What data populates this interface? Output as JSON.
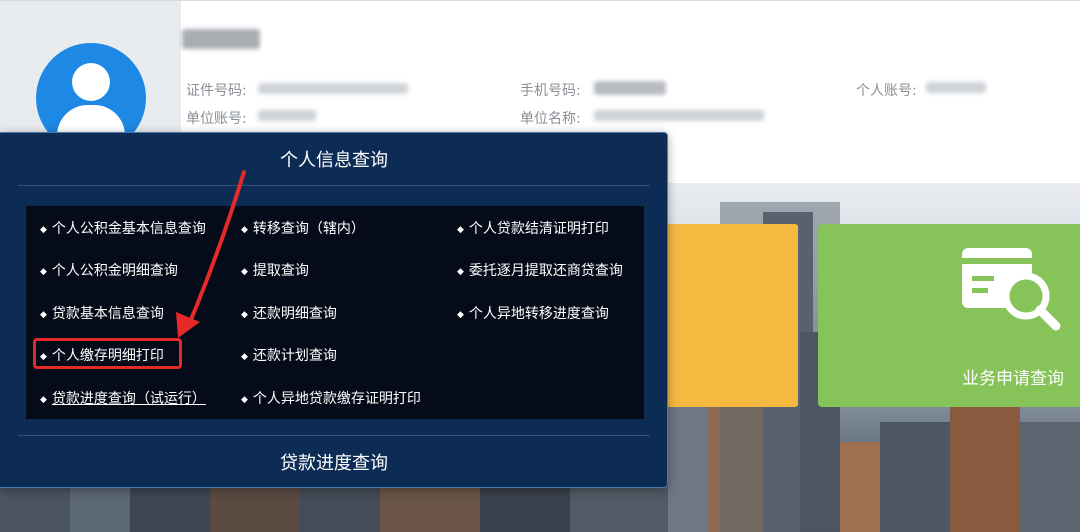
{
  "profile": {
    "fields": {
      "id_number_label": "证件号码:",
      "phone_label": "手机号码:",
      "account_label": "个人账号:",
      "unit_account_label": "单位账号:",
      "unit_name_label": "单位名称:"
    }
  },
  "panel": {
    "title": "个人信息查询",
    "bottom_title": "贷款进度查询",
    "bullet": "◆",
    "menu": {
      "col1": [
        "个人公积金基本信息查询",
        "个人公积金明细查询",
        "贷款基本信息查询",
        "个人缴存明细打印",
        "贷款进度查询（试运行）"
      ],
      "col2": [
        "转移查询（辖内）",
        "提取查询",
        "还款明细查询",
        "还款计划查询",
        "个人异地贷款缴存证明打印"
      ],
      "col3": [
        "个人贷款结清证明打印",
        "委托逐月提取还商贷查询",
        "个人异地转移进度查询"
      ]
    }
  },
  "tiles": {
    "business_query": "业务申请查询"
  },
  "colors": {
    "panel_bg": "#0d2c55",
    "highlight": "#e62a2a",
    "tile_yellow": "#f5b942",
    "tile_green": "#86c45a",
    "avatar": "#1e88e5"
  }
}
